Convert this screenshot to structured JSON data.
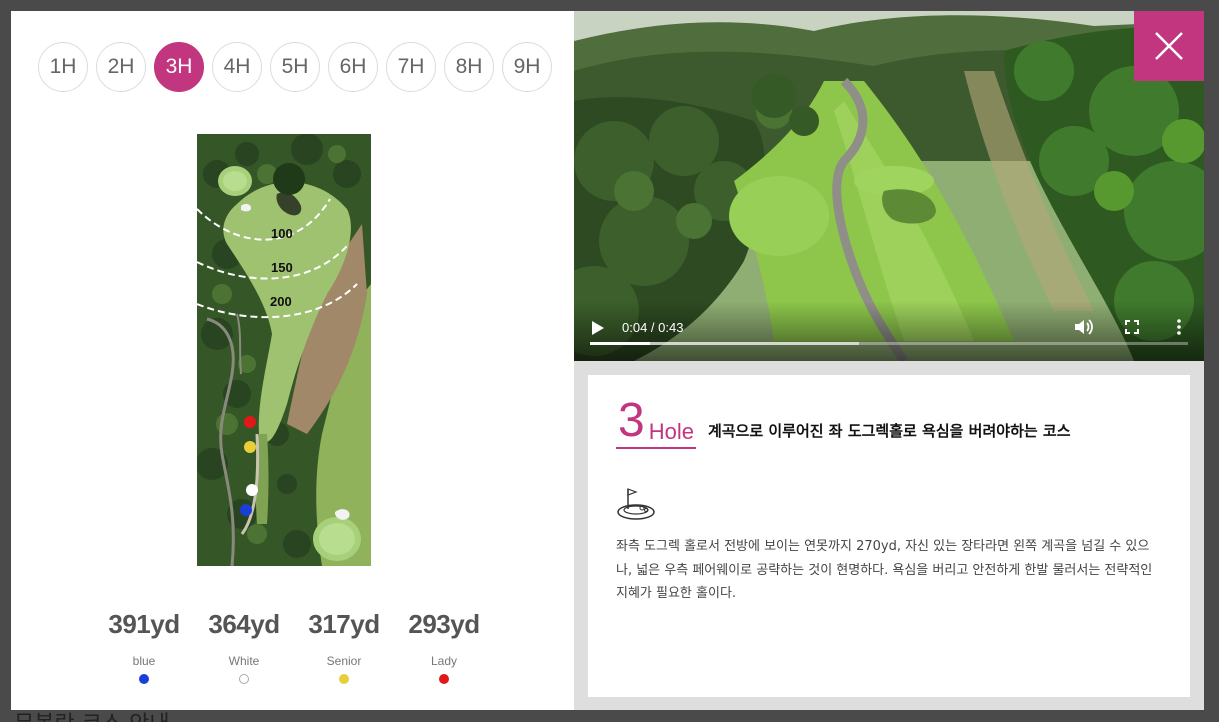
{
  "holes": [
    "1H",
    "2H",
    "3H",
    "4H",
    "5H",
    "6H",
    "7H",
    "8H",
    "9H"
  ],
  "active_hole": "3H",
  "map": {
    "distance_markers": [
      "100",
      "150",
      "200"
    ]
  },
  "tees": [
    {
      "yardage": "391yd",
      "label": "blue",
      "color": "#1a3fd6"
    },
    {
      "yardage": "364yd",
      "label": "White",
      "color": "#ffffff"
    },
    {
      "yardage": "317yd",
      "label": "Senior",
      "color": "#e8cf3a"
    },
    {
      "yardage": "293yd",
      "label": "Lady",
      "color": "#e01818"
    }
  ],
  "video": {
    "time": "0:04 / 0:43",
    "played_fraction": 0.1,
    "buffered_fraction": 0.45
  },
  "hole_info": {
    "number": "3",
    "word": "Hole",
    "subtitle": "계곡으로 이루어진 좌 도그렉홀로 욕심을 버려야하는 코스",
    "description": "좌측 도그렉 홀로서 전방에 보이는 연못까지 270yd, 자신 있는 장타라면 왼쪽 계곡을 넘길 수 있으나, 넓은 우측 페어웨이로 공략하는 것이 현명하다. 욕심을 버리고 안전하게 한발 물러서는 전략적인 지혜가 필요한 홀이다."
  },
  "background_text": "무봉란 코스 안내",
  "colors": {
    "accent": "#c2367f"
  }
}
